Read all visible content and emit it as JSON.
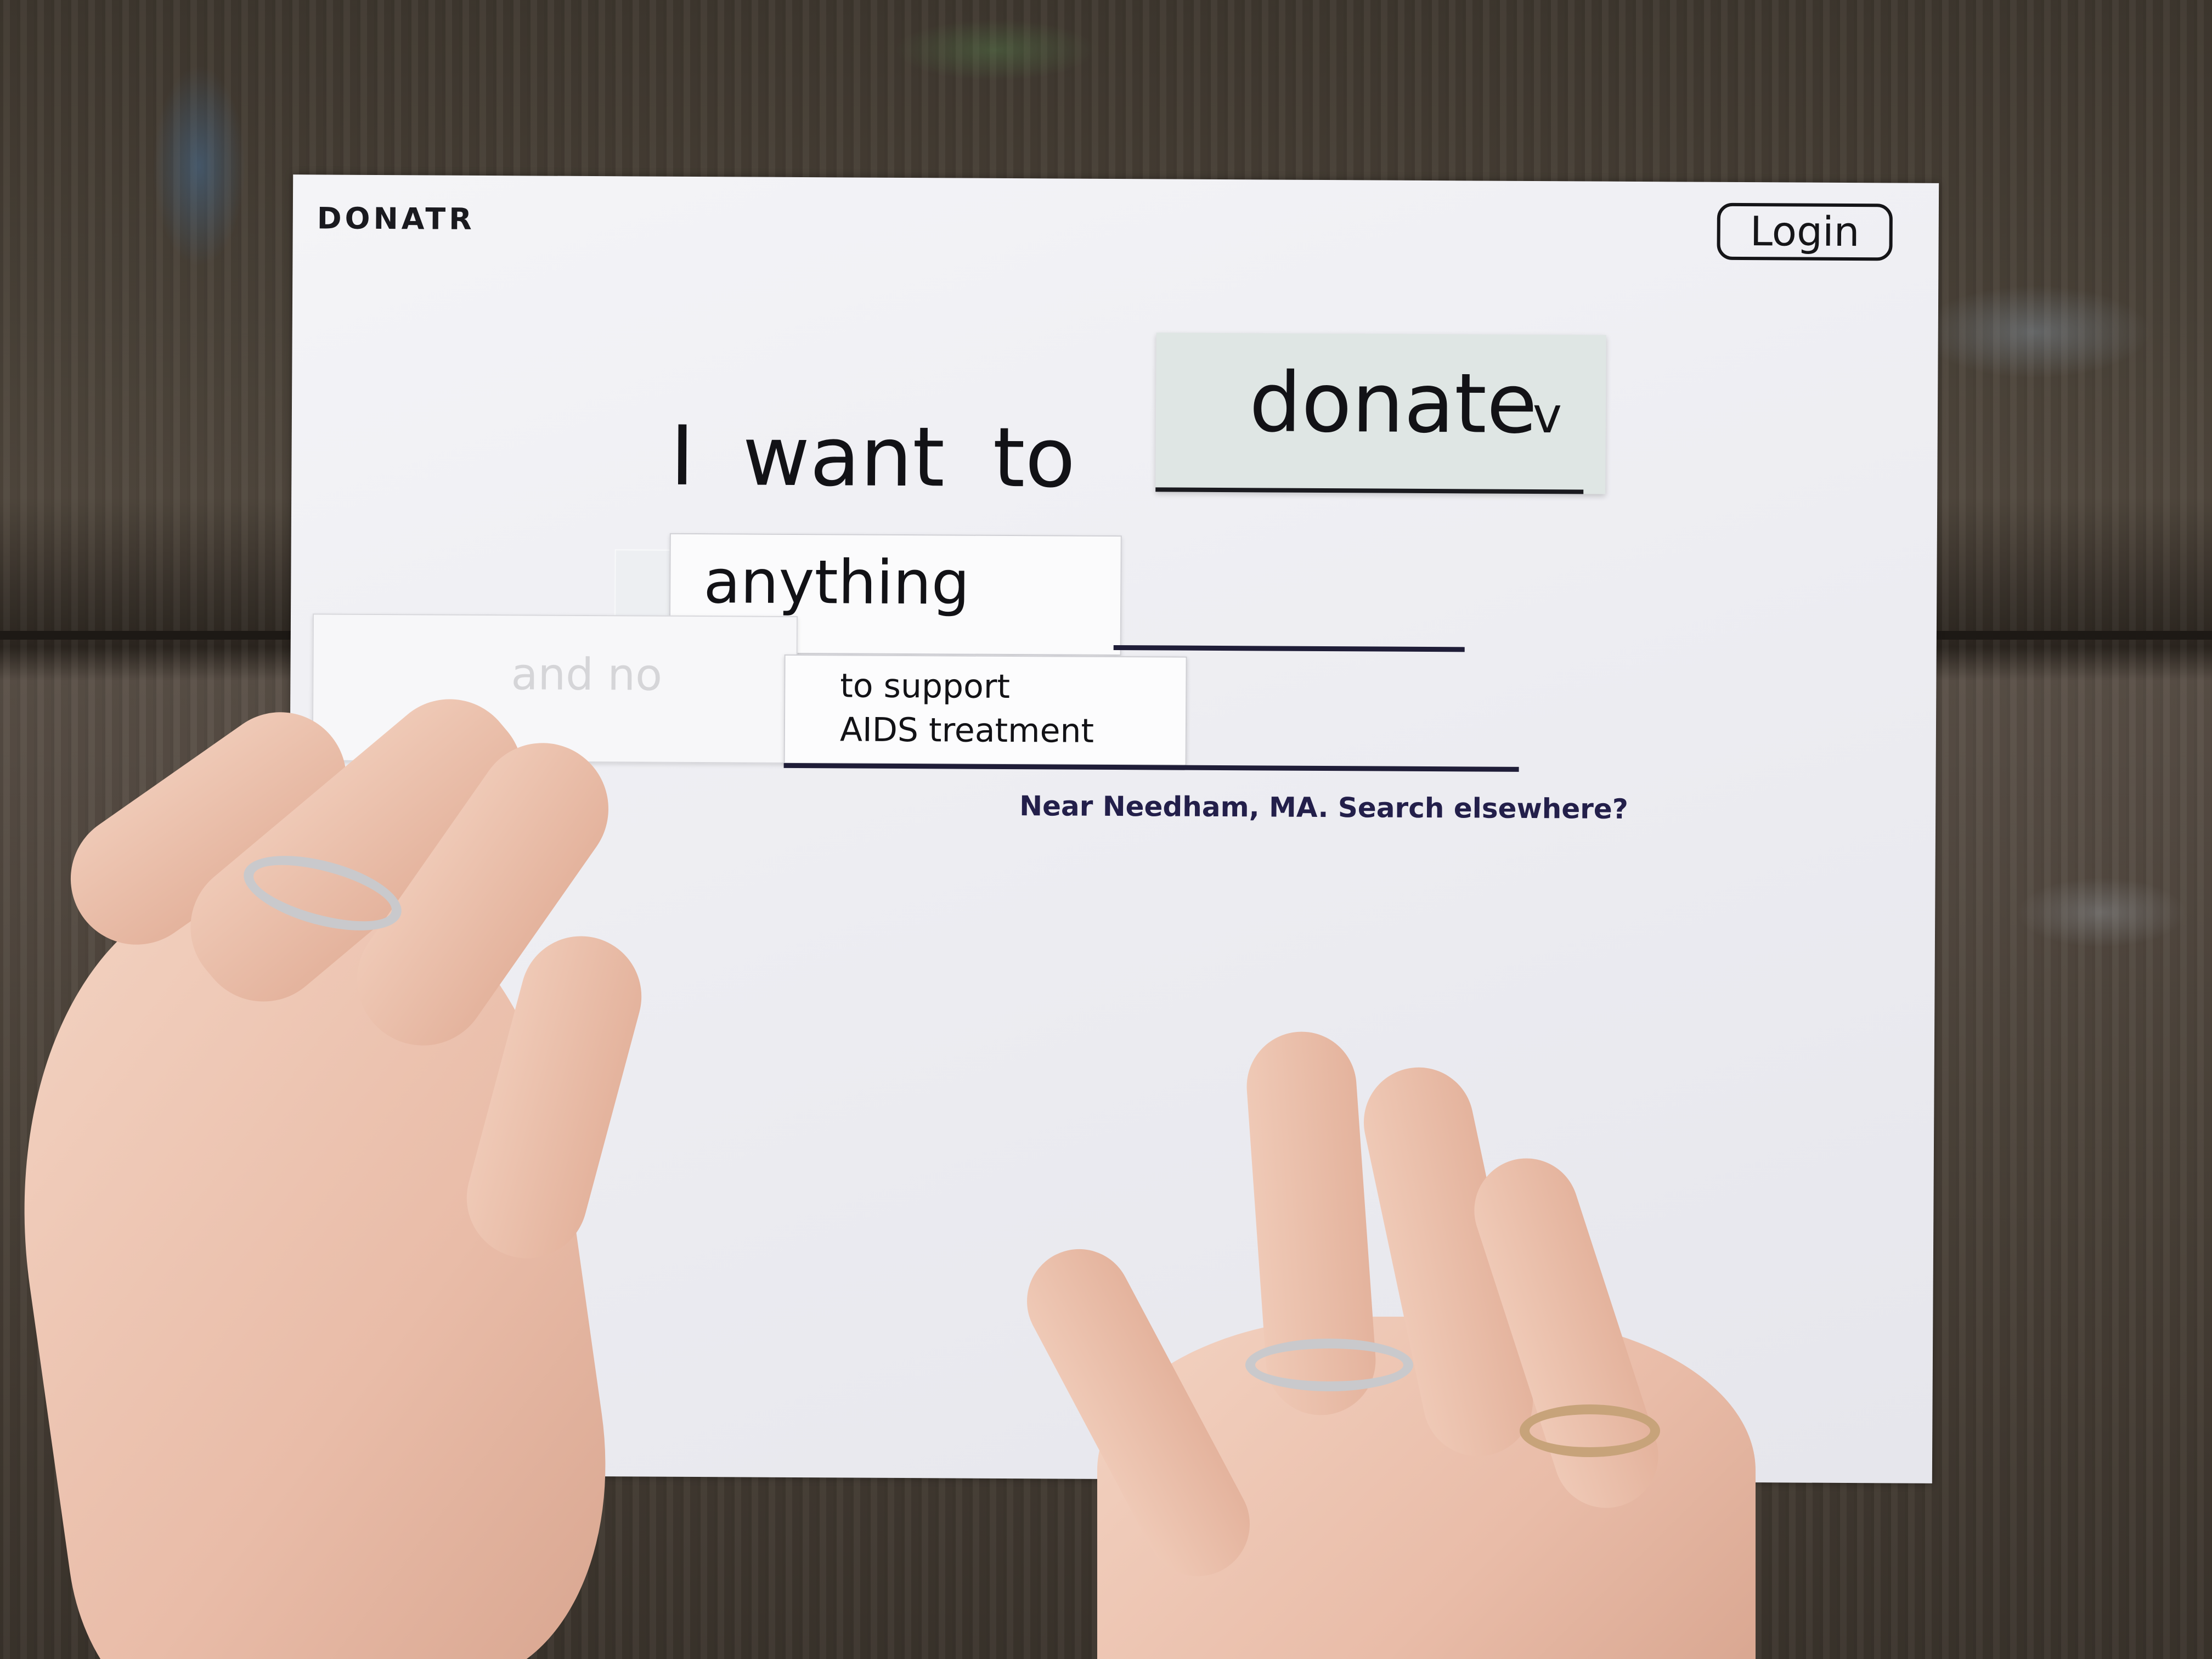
{
  "app": {
    "logo": "DONATR",
    "login_label": "Login"
  },
  "search_sentence": {
    "prefix": "I want to",
    "action_dropdown": {
      "selected": "donate",
      "chevron": "v"
    },
    "what_field": {
      "value": "anything"
    },
    "faded_option": {
      "value": "and no"
    },
    "cause_field": {
      "line1": "to support",
      "line2": "AIDS treatment"
    }
  },
  "location": {
    "text": "Near Needham, MA.",
    "link": "Search elsewhere?"
  },
  "icons": {
    "dropdown": "chevron-down-icon"
  },
  "colors": {
    "ink": "#141418",
    "location_ink": "#231f4a",
    "dropdown_card": "#dfe6e4",
    "paper": "#f0f0f4"
  }
}
